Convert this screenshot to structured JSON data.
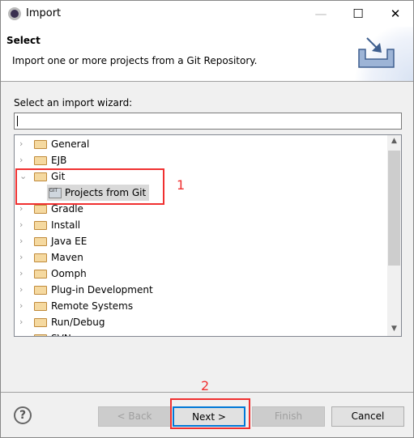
{
  "window": {
    "title": "Import",
    "minimize": "—",
    "maximize": "☐",
    "close": "✕"
  },
  "header": {
    "title": "Select",
    "description": "Import one or more projects from a Git Repository."
  },
  "wizard": {
    "label": "Select an import wizard:",
    "filter_value": ""
  },
  "tree": {
    "items": [
      {
        "label": "General",
        "expanded": false
      },
      {
        "label": "EJB",
        "expanded": false
      },
      {
        "label": "Git",
        "expanded": true
      },
      {
        "label": "Projects from Git",
        "child": true,
        "selected": true
      },
      {
        "label": "Gradle",
        "expanded": false
      },
      {
        "label": "Install",
        "expanded": false
      },
      {
        "label": "Java EE",
        "expanded": false
      },
      {
        "label": "Maven",
        "expanded": false
      },
      {
        "label": "Oomph",
        "expanded": false
      },
      {
        "label": "Plug-in Development",
        "expanded": false
      },
      {
        "label": "Remote Systems",
        "expanded": false
      },
      {
        "label": "Run/Debug",
        "expanded": false
      },
      {
        "label": "SVN",
        "expanded": false
      }
    ]
  },
  "annotations": {
    "one": "1",
    "two": "2",
    "color": "#f03030"
  },
  "buttons": {
    "help": "?",
    "back": "< Back",
    "next": "Next >",
    "finish": "Finish",
    "cancel": "Cancel"
  }
}
